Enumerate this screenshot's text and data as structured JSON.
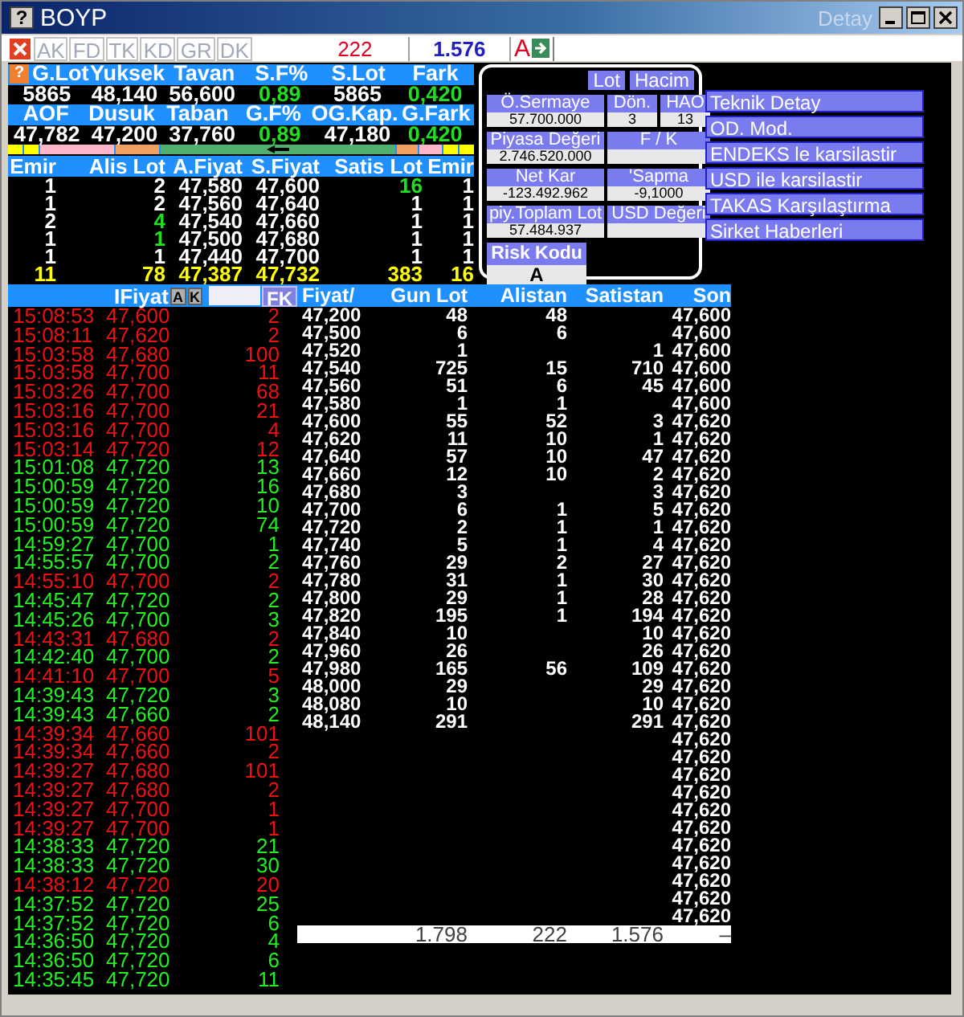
{
  "window": {
    "help": "?",
    "title": "BOYP",
    "detail": {
      "label": "Detay",
      "disabled": true
    }
  },
  "toolbar": {
    "tabs": [
      {
        "label": "AK",
        "disabled": true
      },
      {
        "label": "FD",
        "disabled": true
      },
      {
        "label": "TK",
        "disabled": true
      },
      {
        "label": "KD",
        "disabled": true
      },
      {
        "label": "GR",
        "disabled": true
      },
      {
        "label": "DK",
        "disabled": true
      }
    ],
    "sell_total": "222",
    "buy_total": "1.576",
    "risk": "A"
  },
  "stats_help": "?",
  "stats": [
    {
      "kind": "header",
      "cells": [
        {
          "text": "G.Lot"
        },
        {
          "text": "Yuksek"
        },
        {
          "text": "Tavan"
        },
        {
          "text": "S.F%"
        },
        {
          "text": "S.Lot"
        },
        {
          "text": "Fark"
        }
      ]
    },
    {
      "kind": "values",
      "cells": [
        {
          "text": "5865",
          "positive": false
        },
        {
          "text": "48,140",
          "positive": false
        },
        {
          "text": "56,600",
          "positive": false
        },
        {
          "text": "0,89",
          "positive": true
        },
        {
          "text": "5865",
          "positive": false
        },
        {
          "text": "0,420",
          "positive": true
        }
      ]
    },
    {
      "kind": "header",
      "cells": [
        {
          "text": "AOF"
        },
        {
          "text": "Dusuk"
        },
        {
          "text": "Taban"
        },
        {
          "text": "G.F%"
        },
        {
          "text": "OG.Kap."
        },
        {
          "text": "G.Fark"
        }
      ]
    },
    {
      "kind": "values",
      "cells": [
        {
          "text": "47,782",
          "positive": false
        },
        {
          "text": "47,200",
          "positive": false
        },
        {
          "text": "37,760",
          "positive": false
        },
        {
          "text": "0,89",
          "positive": true
        },
        {
          "text": "47,180",
          "positive": false
        },
        {
          "text": "0,420",
          "positive": true
        }
      ]
    }
  ],
  "indicator_bar": [
    {
      "color": "#ffff00"
    },
    {
      "color": "#ffff00"
    },
    {
      "color": "#ffb6c8"
    },
    {
      "color": "#f0a060"
    },
    {
      "color": "#50b070",
      "arrow": true
    },
    {
      "color": "#f0a060"
    },
    {
      "color": "#ffb6c8"
    },
    {
      "color": "#ffff00"
    },
    {
      "color": "#ffff00"
    }
  ],
  "order_book": {
    "columns": [
      "Emir",
      "Alis Lot",
      "A.Fiyat",
      "S.Fiyat",
      "Satis Lot",
      "Emir"
    ],
    "rows": [
      {
        "bid_orders": "1",
        "bid_lot": "2",
        "bid_lot_up": false,
        "bid": "47,580",
        "ask": "47,600",
        "ask_lot": "16",
        "ask_lot_up": true,
        "ask_orders": "1"
      },
      {
        "bid_orders": "1",
        "bid_lot": "2",
        "bid_lot_up": false,
        "bid": "47,560",
        "ask": "47,640",
        "ask_lot": "1",
        "ask_lot_up": false,
        "ask_orders": "1"
      },
      {
        "bid_orders": "2",
        "bid_lot": "4",
        "bid_lot_up": true,
        "bid": "47,540",
        "ask": "47,660",
        "ask_lot": "1",
        "ask_lot_up": false,
        "ask_orders": "1"
      },
      {
        "bid_orders": "1",
        "bid_lot": "1",
        "bid_lot_up": true,
        "bid": "47,500",
        "ask": "47,680",
        "ask_lot": "1",
        "ask_lot_up": false,
        "ask_orders": "1"
      },
      {
        "bid_orders": "1",
        "bid_lot": "1",
        "bid_lot_up": false,
        "bid": "47,440",
        "ask": "47,700",
        "ask_lot": "1",
        "ask_lot_up": false,
        "ask_orders": "1"
      }
    ],
    "totals": [
      "11",
      "78",
      "47,387",
      "47,732",
      "383",
      "16"
    ]
  },
  "info_panel": {
    "buttons": [
      "Lot",
      "Hacim"
    ],
    "fields": [
      {
        "label": "Ö.Sermaye",
        "value": "57.700.000",
        "kind": "wide"
      },
      {
        "label": "Dön.",
        "value": "3",
        "kind": "narrow"
      },
      {
        "label": "HAO",
        "value": "13",
        "kind": "narrow"
      },
      {
        "label": "Piyasa Değeri",
        "value": "2.746.520.000",
        "kind": "wide"
      },
      {
        "label": "F / K",
        "kind": "double"
      },
      {
        "label": "Net Kar",
        "value": "-123.492.962",
        "kind": "wide"
      },
      {
        "label": "'Sapma",
        "value": "-9,1000",
        "kind": "double"
      },
      {
        "label": "piy.Toplam Lot",
        "value": "57.484.937",
        "kind": "wide"
      },
      {
        "label": "USD Değeri",
        "kind": "double"
      }
    ],
    "risk": {
      "label": "Risk Kodu",
      "value": "A"
    }
  },
  "menu": [
    "Teknik Detay",
    "OD. Mod.",
    "ENDEKS le karsilastir",
    "USD ile karsilastir",
    "TAKAS Karşılaştırma",
    "Sirket Haberleri"
  ],
  "trades": {
    "header": "IFiyat",
    "buttons": [
      "A",
      "K",
      "FK"
    ],
    "rows": [
      {
        "time": "15:08:53",
        "price": "47,600",
        "lot": "2",
        "sell": true
      },
      {
        "time": "15:08:11",
        "price": "47,620",
        "lot": "2",
        "sell": true
      },
      {
        "time": "15:03:58",
        "price": "47,680",
        "lot": "100",
        "sell": true
      },
      {
        "time": "15:03:58",
        "price": "47,700",
        "lot": "11",
        "sell": true
      },
      {
        "time": "15:03:26",
        "price": "47,700",
        "lot": "68",
        "sell": true
      },
      {
        "time": "15:03:16",
        "price": "47,700",
        "lot": "21",
        "sell": true
      },
      {
        "time": "15:03:16",
        "price": "47,700",
        "lot": "4",
        "sell": true
      },
      {
        "time": "15:03:14",
        "price": "47,720",
        "lot": "12",
        "sell": true
      },
      {
        "time": "15:01:08",
        "price": "47,720",
        "lot": "13",
        "sell": false
      },
      {
        "time": "15:00:59",
        "price": "47,720",
        "lot": "16",
        "sell": false
      },
      {
        "time": "15:00:59",
        "price": "47,720",
        "lot": "10",
        "sell": false
      },
      {
        "time": "15:00:59",
        "price": "47,720",
        "lot": "74",
        "sell": false
      },
      {
        "time": "14:59:27",
        "price": "47,700",
        "lot": "1",
        "sell": false
      },
      {
        "time": "14:55:57",
        "price": "47,700",
        "lot": "2",
        "sell": false
      },
      {
        "time": "14:55:10",
        "price": "47,700",
        "lot": "2",
        "sell": true
      },
      {
        "time": "14:45:47",
        "price": "47,720",
        "lot": "2",
        "sell": false
      },
      {
        "time": "14:45:26",
        "price": "47,700",
        "lot": "3",
        "sell": false
      },
      {
        "time": "14:43:31",
        "price": "47,680",
        "lot": "2",
        "sell": true
      },
      {
        "time": "14:42:40",
        "price": "47,700",
        "lot": "2",
        "sell": false
      },
      {
        "time": "14:41:10",
        "price": "47,700",
        "lot": "5",
        "sell": true
      },
      {
        "time": "14:39:43",
        "price": "47,720",
        "lot": "3",
        "sell": false
      },
      {
        "time": "14:39:43",
        "price": "47,660",
        "lot": "2",
        "sell": false
      },
      {
        "time": "14:39:34",
        "price": "47,660",
        "lot": "101",
        "sell": true
      },
      {
        "time": "14:39:34",
        "price": "47,660",
        "lot": "2",
        "sell": true
      },
      {
        "time": "14:39:27",
        "price": "47,680",
        "lot": "101",
        "sell": true
      },
      {
        "time": "14:39:27",
        "price": "47,680",
        "lot": "2",
        "sell": true
      },
      {
        "time": "14:39:27",
        "price": "47,700",
        "lot": "1",
        "sell": true
      },
      {
        "time": "14:39:27",
        "price": "47,700",
        "lot": "1",
        "sell": true
      },
      {
        "time": "14:38:33",
        "price": "47,720",
        "lot": "21",
        "sell": false
      },
      {
        "time": "14:38:33",
        "price": "47,720",
        "lot": "30",
        "sell": false
      },
      {
        "time": "14:38:12",
        "price": "47,720",
        "lot": "20",
        "sell": true
      },
      {
        "time": "14:37:52",
        "price": "47,720",
        "lot": "25",
        "sell": false
      },
      {
        "time": "14:37:52",
        "price": "47,720",
        "lot": "6",
        "sell": false
      },
      {
        "time": "14:36:50",
        "price": "47,720",
        "lot": "4",
        "sell": false
      },
      {
        "time": "14:36:50",
        "price": "47,720",
        "lot": "6",
        "sell": false
      },
      {
        "time": "14:35:45",
        "price": "47,720",
        "lot": "11",
        "sell": false
      }
    ]
  },
  "price_table": {
    "columns": [
      "Fiyat/",
      "Gun Lot",
      "Alistan",
      "Satistan",
      "Son"
    ],
    "rows": [
      {
        "fiyat": "47,200",
        "gun_lot": "48",
        "alistan": "48",
        "son": "47,600"
      },
      {
        "fiyat": "47,500",
        "gun_lot": "6",
        "alistan": "6",
        "son": "47,600"
      },
      {
        "fiyat": "47,520",
        "gun_lot": "1",
        "satistan": "1",
        "son": "47,600"
      },
      {
        "fiyat": "47,540",
        "gun_lot": "725",
        "alistan": "15",
        "satistan": "710",
        "son": "47,600"
      },
      {
        "fiyat": "47,560",
        "gun_lot": "51",
        "alistan": "6",
        "satistan": "45",
        "son": "47,600"
      },
      {
        "fiyat": "47,580",
        "gun_lot": "1",
        "alistan": "1",
        "son": "47,600"
      },
      {
        "fiyat": "47,600",
        "gun_lot": "55",
        "alistan": "52",
        "satistan": "3",
        "son": "47,620"
      },
      {
        "fiyat": "47,620",
        "gun_lot": "11",
        "alistan": "10",
        "satistan": "1",
        "son": "47,620"
      },
      {
        "fiyat": "47,640",
        "gun_lot": "57",
        "alistan": "10",
        "satistan": "47",
        "son": "47,620"
      },
      {
        "fiyat": "47,660",
        "gun_lot": "12",
        "alistan": "10",
        "satistan": "2",
        "son": "47,620"
      },
      {
        "fiyat": "47,680",
        "gun_lot": "3",
        "satistan": "3",
        "son": "47,620"
      },
      {
        "fiyat": "47,700",
        "gun_lot": "6",
        "alistan": "1",
        "satistan": "5",
        "son": "47,620"
      },
      {
        "fiyat": "47,720",
        "gun_lot": "2",
        "alistan": "1",
        "satistan": "1",
        "son": "47,620"
      },
      {
        "fiyat": "47,740",
        "gun_lot": "5",
        "alistan": "1",
        "satistan": "4",
        "son": "47,620"
      },
      {
        "fiyat": "47,760",
        "gun_lot": "29",
        "alistan": "2",
        "satistan": "27",
        "son": "47,620"
      },
      {
        "fiyat": "47,780",
        "gun_lot": "31",
        "alistan": "1",
        "satistan": "30",
        "son": "47,620"
      },
      {
        "fiyat": "47,800",
        "gun_lot": "29",
        "alistan": "1",
        "satistan": "28",
        "son": "47,620"
      },
      {
        "fiyat": "47,820",
        "gun_lot": "195",
        "alistan": "1",
        "satistan": "194",
        "son": "47,620"
      },
      {
        "fiyat": "47,840",
        "gun_lot": "10",
        "satistan": "10",
        "son": "47,620"
      },
      {
        "fiyat": "47,960",
        "gun_lot": "26",
        "satistan": "26",
        "son": "47,620"
      },
      {
        "fiyat": "47,980",
        "gun_lot": "165",
        "alistan": "56",
        "satistan": "109",
        "son": "47,620"
      },
      {
        "fiyat": "48,000",
        "gun_lot": "29",
        "satistan": "29",
        "son": "47,620"
      },
      {
        "fiyat": "48,080",
        "gun_lot": "10",
        "satistan": "10",
        "son": "47,620"
      },
      {
        "fiyat": "48,140",
        "gun_lot": "291",
        "satistan": "291",
        "son": "47,620"
      },
      {
        "son": "47,620"
      },
      {
        "son": "47,620"
      },
      {
        "son": "47,620"
      },
      {
        "son": "47,620"
      },
      {
        "son": "47,620"
      },
      {
        "son": "47,620"
      },
      {
        "son": "47,620"
      },
      {
        "son": "47,620"
      },
      {
        "son": "47,620"
      },
      {
        "son": "47,620"
      },
      {
        "son": "47,620"
      }
    ],
    "totals": {
      "gun_lot": "1.798",
      "alistan": "222",
      "satistan": "1.576",
      "son": "–"
    }
  }
}
